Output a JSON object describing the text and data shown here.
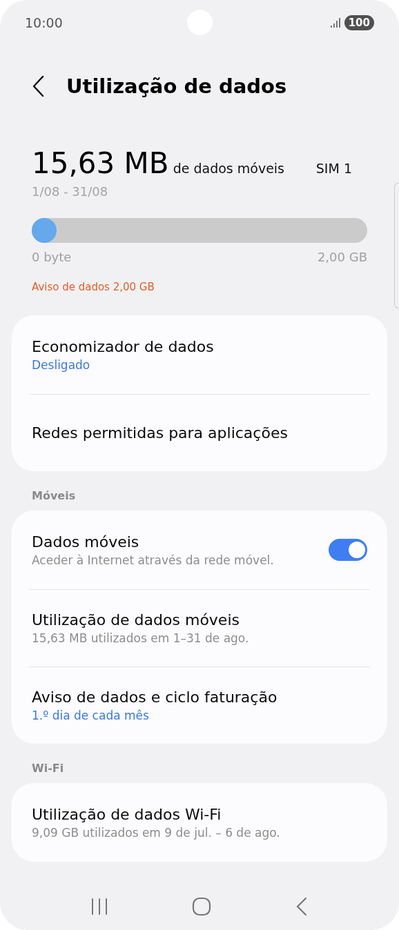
{
  "status_bar": {
    "time": "10:00",
    "battery": "100"
  },
  "header": {
    "title": "Utilização de dados"
  },
  "usage": {
    "amount": "15,63 MB",
    "unit_label": "de dados móveis",
    "sim": "SIM 1",
    "period": "1/08 - 31/08",
    "level": 0.0076,
    "min_label": "0 byte",
    "max_label": "2,00 GB",
    "warning": "Aviso de dados 2,00 GB"
  },
  "sections": [
    {
      "rows": [
        {
          "kind": "plain",
          "title": "Economizador de dados",
          "subtitle": {
            "kind": "value",
            "text": "Desligado"
          }
        },
        {
          "kind": "plain",
          "title": "Redes permitidas para aplicações"
        }
      ]
    },
    {
      "header": "Móveis",
      "rows": [
        {
          "kind": "toggle",
          "title": "Dados móveis",
          "subtitle": {
            "kind": "note",
            "text": "Aceder à Internet através da rede móvel."
          },
          "on": true
        },
        {
          "kind": "plain",
          "title": "Utilização de dados móveis",
          "subtitle": {
            "kind": "note",
            "text": "15,63 MB utilizados em 1–31 de ago."
          }
        },
        {
          "kind": "plain",
          "title": "Aviso de dados e ciclo faturação",
          "subtitle": {
            "kind": "value",
            "text": "1.º dia de cada mês"
          }
        }
      ]
    },
    {
      "header": "Wi-Fi",
      "rows": [
        {
          "kind": "plain",
          "title": "Utilização de dados Wi-Fi",
          "subtitle": {
            "kind": "note",
            "text": "9,09 GB utilizados em 9 de jul. – 6 de ago."
          }
        }
      ]
    }
  ]
}
